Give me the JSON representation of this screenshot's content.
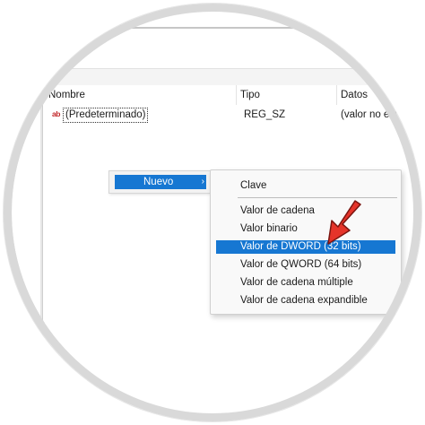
{
  "list_headers": {
    "name": "Nombre",
    "type": "Tipo",
    "data": "Datos"
  },
  "rows": [
    {
      "icon": "ab",
      "name": "(Predeterminado)",
      "type": "REG_SZ",
      "data": "(valor no est"
    }
  ],
  "context_menu": {
    "new_label": "Nuevo"
  },
  "submenu": {
    "items": [
      "Clave",
      "Valor de cadena",
      "Valor binario",
      "Valor de DWORD (32 bits)",
      "Valor de QWORD (64 bits)",
      "Valor de cadena múltiple",
      "Valor de cadena expandible"
    ],
    "highlighted": "Valor de DWORD (32 bits)"
  },
  "colors": {
    "highlight": "#1677d2",
    "arrow": "#e5342a",
    "ring": "#d9d9d9"
  },
  "icons": {
    "string_value": "reg-string-icon",
    "submenu_chevron": "chevron-right-icon",
    "pointer": "red-arrow-icon"
  }
}
